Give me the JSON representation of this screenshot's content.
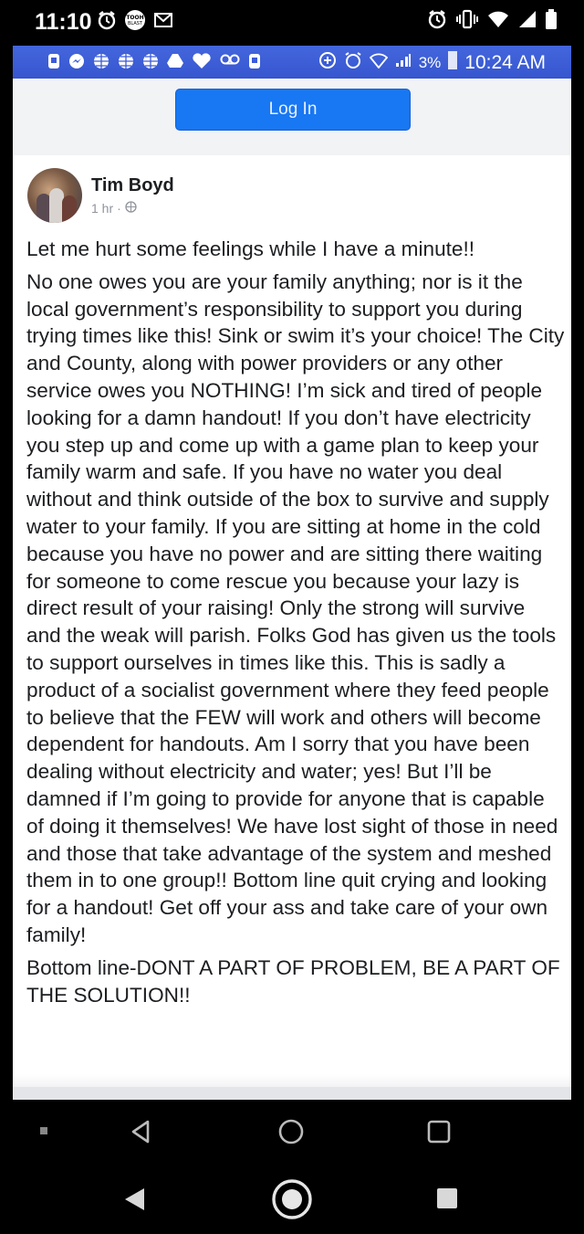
{
  "outer_status": {
    "time": "11:10",
    "left_icons": [
      "alarm-icon",
      "app-badge-icon",
      "gmail-icon"
    ],
    "badge_text": "TOOH BLAST",
    "right_icons": [
      "alarm-icon",
      "vibrate-icon",
      "wifi-icon",
      "signal-icon",
      "battery-icon"
    ]
  },
  "inner_status": {
    "left_icons": [
      "notification-icon",
      "messenger-icon",
      "globe-icon",
      "globe-icon",
      "globe-icon",
      "drive-icon",
      "iheart-icon",
      "voicemail-icon",
      "notification-icon"
    ],
    "battery_percent": "3%",
    "time": "10:24 AM",
    "bar_color": "#3b5bdb"
  },
  "login": {
    "button_label": "Log In",
    "button_color": "#1877f2"
  },
  "post": {
    "author": "Tim Boyd",
    "timestamp": "1 hr",
    "separator": "·",
    "privacy_icon": "globe-icon",
    "paragraphs": [
      "Let me hurt some feelings while I have a minute!!",
      "No one owes you are your family anything; nor is it the local government’s responsibility to support you during trying times like this! Sink or swim it’s your choice! The City and County, along with power providers or any other service owes you NOTHING! I’m sick and tired of people looking for a damn handout! If you don’t have electricity you step up and come up with a game plan to keep your family warm and safe. If you have no water you deal without and think outside of the box to survive and supply water to your family. If you are sitting at home in the cold because you have no power and are sitting there waiting for someone to come rescue you because your lazy is direct result of your raising! Only the strong will survive and the weak will parish. Folks God has given us the tools to support ourselves in times like this. This is sadly a product of a socialist government where they feed people to believe that the FEW will work and others will become dependent for handouts. Am I sorry that you have been dealing without electricity and water; yes! But I’ll be damned if I’m going to provide for anyone that is capable of doing it themselves! We have lost sight of those in need and those that take advantage of the system and meshed them in to one group!! Bottom line quit crying and looking for a handout! Get off your ass and take care of your own family!",
      "Bottom line-DONT A PART OF PROBLEM, BE A PART OF THE SOLUTION!!"
    ]
  },
  "inner_nav": [
    "menu-dot-icon",
    "back-icon",
    "home-icon",
    "recents-icon"
  ],
  "outer_nav": [
    "back-icon",
    "home-icon",
    "recents-icon"
  ]
}
